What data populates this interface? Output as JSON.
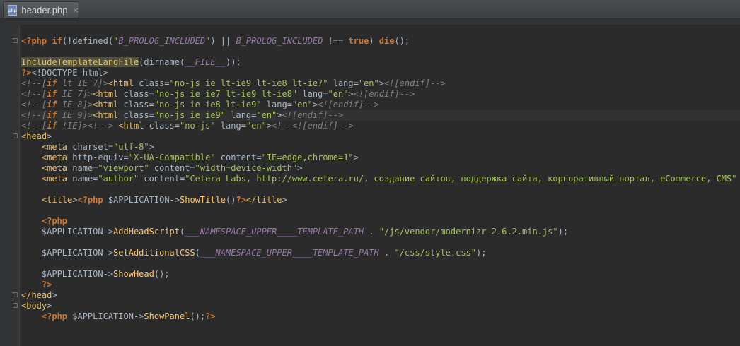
{
  "tab": {
    "label": "header.php",
    "close": "×",
    "icon_text": "php"
  },
  "colors": {
    "background": "#2b2b2b",
    "keyword": "#cc7832",
    "tag": "#e8bf6a",
    "string": "#a5c25c",
    "comment": "#808080",
    "constant": "#9876aa"
  },
  "lines": [
    "<?php if(!defined(\"B_PROLOG_INCLUDED\") || B_PROLOG_INCLUDED !== true) die();",
    "",
    "IncludeTemplateLangFile(dirname(__FILE__));",
    "?><!DOCTYPE html>",
    "<!--[if lt IE 7]><html class=\"no-js ie lt-ie9 lt-ie8 lt-ie7\" lang=\"en\"><![endif]-->",
    "<!--[if IE 7]><html class=\"no-js ie ie7 lt-ie9 lt-ie8\" lang=\"en\"><![endif]-->",
    "<!--[if IE 8]><html class=\"no-js ie ie8 lt-ie9\" lang=\"en\"><![endif]-->",
    "<!--[if IE 9]><html class=\"no-js ie ie9\" lang=\"en\"><![endif]-->",
    "<!--[if !IE]><!--> <html class=\"no-js\" lang=\"en\"><!--<![endif]-->",
    "<head>",
    "    <meta charset=\"utf-8\">",
    "    <meta http-equiv=\"X-UA-Compatible\" content=\"IE=edge,chrome=1\">",
    "    <meta name=\"viewport\" content=\"width=device-width\">",
    "    <meta name=\"author\" content=\"Cetera Labs, http://www.cetera.ru/, создание сайтов, поддержка сайта, корпоративный портал, eCommerce, CMS\" />",
    "",
    "    <title><?php $APPLICATION->ShowTitle()?></title>",
    "",
    "    <?php",
    "    $APPLICATION->AddHeadScript(___NAMESPACE_UPPER____TEMPLATE_PATH . \"/js/vendor/modernizr-2.6.2.min.js\");",
    "",
    "    $APPLICATION->SetAdditionalCSS(___NAMESPACE_UPPER____TEMPLATE_PATH . \"/css/style.css\");",
    "",
    "    $APPLICATION->ShowHead();",
    "    ?>",
    "</head>",
    "<body>",
    "    <?php $APPLICATION->ShowPanel();?>",
    "",
    ""
  ]
}
